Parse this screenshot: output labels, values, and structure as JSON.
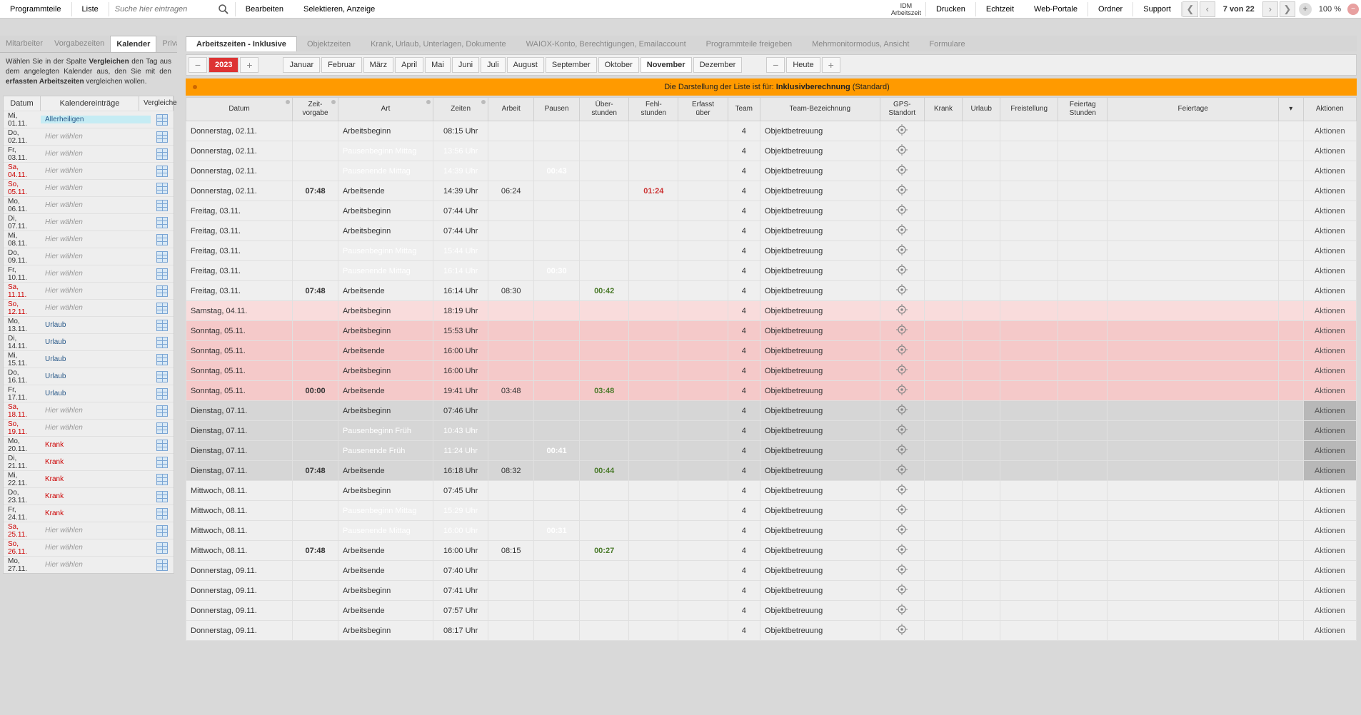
{
  "toolbar": {
    "programmteile": "Programmteile",
    "liste": "Liste",
    "search_placeholder": "Suche hier eintragen",
    "bearbeiten": "Bearbeiten",
    "selektieren": "Selektieren, Anzeige",
    "idm_line1": "IDM",
    "idm_line2": "Arbeitszeit",
    "drucken": "Drucken",
    "echtzeit": "Echtzeit",
    "webportale": "Web-Portale",
    "ordner": "Ordner",
    "support": "Support",
    "page_counter": "7 von 22",
    "zoom": "100 %"
  },
  "sidebar": {
    "tabs": [
      "Mitarbeiter",
      "Vorgabezeiten",
      "Kalender",
      "Privatdaten"
    ],
    "active_tab": 2,
    "info_parts": [
      "Wählen Sie in der Spalte ",
      "Vergleichen",
      " den Tag aus dem angelegten Kalender aus, den Sie mit den ",
      "erfassten Arbeitszeiten",
      " vergleichen wollen."
    ],
    "cal_head": {
      "date": "Datum",
      "entry": "Kalendereinträge",
      "cmp": "Vergleichen"
    },
    "cal_rows": [
      {
        "date": "Mi, 01.11.",
        "entry": "Allerheiligen",
        "cls": "holiday"
      },
      {
        "date": "Do, 02.11.",
        "entry": "Hier wählen",
        "cls": ""
      },
      {
        "date": "Fr, 03.11.",
        "entry": "Hier wählen",
        "cls": ""
      },
      {
        "date": "Sa, 04.11.",
        "entry": "Hier wählen",
        "cls": "",
        "dcls": "sat"
      },
      {
        "date": "So, 05.11.",
        "entry": "Hier wählen",
        "cls": "",
        "dcls": "sun"
      },
      {
        "date": "Mo, 06.11.",
        "entry": "Hier wählen",
        "cls": ""
      },
      {
        "date": "Di, 07.11.",
        "entry": "Hier wählen",
        "cls": ""
      },
      {
        "date": "Mi, 08.11.",
        "entry": "Hier wählen",
        "cls": ""
      },
      {
        "date": "Do, 09.11.",
        "entry": "Hier wählen",
        "cls": ""
      },
      {
        "date": "Fr, 10.11.",
        "entry": "Hier wählen",
        "cls": ""
      },
      {
        "date": "Sa, 11.11.",
        "entry": "Hier wählen",
        "cls": "",
        "dcls": "sat"
      },
      {
        "date": "So, 12.11.",
        "entry": "Hier wählen",
        "cls": "",
        "dcls": "sun"
      },
      {
        "date": "Mo, 13.11.",
        "entry": "Urlaub",
        "cls": "urlaub"
      },
      {
        "date": "Di, 14.11.",
        "entry": "Urlaub",
        "cls": "urlaub"
      },
      {
        "date": "Mi, 15.11.",
        "entry": "Urlaub",
        "cls": "urlaub"
      },
      {
        "date": "Do, 16.11.",
        "entry": "Urlaub",
        "cls": "urlaub"
      },
      {
        "date": "Fr, 17.11.",
        "entry": "Urlaub",
        "cls": "urlaub"
      },
      {
        "date": "Sa, 18.11.",
        "entry": "Hier wählen",
        "cls": "",
        "dcls": "sat"
      },
      {
        "date": "So, 19.11.",
        "entry": "Hier wählen",
        "cls": "",
        "dcls": "sun"
      },
      {
        "date": "Mo, 20.11.",
        "entry": "Krank",
        "cls": "krank"
      },
      {
        "date": "Di, 21.11.",
        "entry": "Krank",
        "cls": "krank"
      },
      {
        "date": "Mi, 22.11.",
        "entry": "Krank",
        "cls": "krank"
      },
      {
        "date": "Do, 23.11.",
        "entry": "Krank",
        "cls": "krank"
      },
      {
        "date": "Fr, 24.11.",
        "entry": "Krank",
        "cls": "krank"
      },
      {
        "date": "Sa, 25.11.",
        "entry": "Hier wählen",
        "cls": "",
        "dcls": "sat"
      },
      {
        "date": "So, 26.11.",
        "entry": "Hier wählen",
        "cls": "",
        "dcls": "sun"
      },
      {
        "date": "Mo, 27.11.",
        "entry": "Hier wählen",
        "cls": ""
      }
    ]
  },
  "main_tabs": [
    "Arbeitszeiten - Inklusive",
    "Objektzeiten",
    "Krank, Urlaub, Unterlagen, Dokumente",
    "WAIOX-Konto, Berechtigungen, Emailaccount",
    "Programmteile freigeben",
    "Mehrmonitormodus, Ansicht",
    "Formulare"
  ],
  "main_tab_active": 0,
  "ym": {
    "year": "2023",
    "months": [
      "Januar",
      "Februar",
      "März",
      "April",
      "Mai",
      "Juni",
      "Juli",
      "August",
      "September",
      "Oktober",
      "November",
      "Dezember"
    ],
    "current": "November",
    "heute": "Heute"
  },
  "notice": {
    "pre": "Die Darstellung der Liste ist für: ",
    "bold": "Inklusivberechnung",
    "post": " (Standard)"
  },
  "dt_head": {
    "date": "Datum",
    "vorg": "Zeit-\nvorgabe",
    "art": "Art",
    "zeit": "Zeiten",
    "arb": "Arbeit",
    "pau": "Pausen",
    "over": "Über-\nstunden",
    "fehl": "Fehl-\nstunden",
    "erf": "Erfasst\nüber",
    "team": "Team",
    "teamb": "Team-Bezeichnung",
    "gps": "GPS-\nStandort",
    "krank": "Krank",
    "urlaub": "Urlaub",
    "frei": "Freistellung",
    "fstd": "Feiertag\nStunden",
    "feier": "Feiertage",
    "act": "Aktionen"
  },
  "rows": [
    {
      "rcls": "r-std",
      "date": "Donnerstag, 02.11.",
      "vorg": "",
      "art": "Arbeitsbeginn",
      "artcls": "c-art",
      "zeit": "08:15 Uhr",
      "zcls": "c-time",
      "arb": "",
      "pau": "",
      "over": "",
      "fehl": "",
      "team": "4",
      "teamb": "Objektbetreuung"
    },
    {
      "rcls": "r-std",
      "date": "Donnerstag, 02.11.",
      "vorg": "",
      "art": "Pausenbeginn Mittag",
      "artcls": "c-art-blue",
      "zeit": "13:56 Uhr",
      "zcls": "c-time-blue",
      "arb": "",
      "pau": "",
      "over": "",
      "fehl": "",
      "team": "4",
      "teamb": "Objektbetreuung"
    },
    {
      "rcls": "r-std",
      "date": "Donnerstag, 02.11.",
      "vorg": "",
      "art": "Pausenende Mittag",
      "artcls": "c-art-blue",
      "zeit": "14:39 Uhr",
      "zcls": "c-time-blue",
      "arb": "",
      "pau": "00:43",
      "paucls": "c-pause-blue",
      "over": "",
      "fehl": "",
      "team": "4",
      "teamb": "Objektbetreuung"
    },
    {
      "rcls": "r-std",
      "date": "Donnerstag, 02.11.",
      "vorg": "07:48",
      "art": "Arbeitsende",
      "artcls": "c-art",
      "zeit": "14:39 Uhr",
      "zcls": "c-time",
      "arb": "06:24",
      "over": "",
      "fehl": "01:24",
      "fehlcls": "red",
      "team": "4",
      "teamb": "Objektbetreuung",
      "efrei": true
    },
    {
      "rcls": "r-std",
      "date": "Freitag, 03.11.",
      "vorg": "",
      "art": "Arbeitsbeginn",
      "artcls": "c-art",
      "zeit": "07:44 Uhr",
      "zcls": "c-time",
      "team": "4",
      "teamb": "Objektbetreuung"
    },
    {
      "rcls": "r-std",
      "date": "Freitag, 03.11.",
      "vorg": "",
      "art": "Arbeitsbeginn",
      "artcls": "c-art",
      "zeit": "07:44 Uhr",
      "zcls": "c-time",
      "team": "4",
      "teamb": "Objektbetreuung"
    },
    {
      "rcls": "r-std",
      "date": "Freitag, 03.11.",
      "vorg": "",
      "art": "Pausenbeginn Mittag",
      "artcls": "c-art-blue",
      "zeit": "15:44 Uhr",
      "zcls": "c-time-blue",
      "team": "4",
      "teamb": "Objektbetreuung"
    },
    {
      "rcls": "r-std",
      "date": "Freitag, 03.11.",
      "vorg": "",
      "art": "Pausenende Mittag",
      "artcls": "c-art-blue",
      "zeit": "16:14 Uhr",
      "zcls": "c-time-blue",
      "pau": "00:30",
      "paucls": "c-pause-blue",
      "team": "4",
      "teamb": "Objektbetreuung"
    },
    {
      "rcls": "r-std",
      "date": "Freitag, 03.11.",
      "vorg": "07:48",
      "art": "Arbeitsende",
      "artcls": "c-art",
      "zeit": "16:14 Uhr",
      "zcls": "c-time",
      "arb": "08:30",
      "over": "00:42",
      "team": "4",
      "teamb": "Objektbetreuung",
      "efrei": true
    },
    {
      "rcls": "r-pinklight",
      "date": "Samstag, 04.11.",
      "vorg": "",
      "art": "Arbeitsbeginn",
      "artcls": "c-art",
      "zeit": "18:19 Uhr",
      "zcls": "c-time",
      "team": "4",
      "teamb": "Objektbetreuung"
    },
    {
      "rcls": "r-pink",
      "date": "Sonntag, 05.11.",
      "vorg": "",
      "art": "Arbeitsbeginn",
      "artcls": "c-art",
      "zeit": "15:53 Uhr",
      "zcls": "c-time",
      "team": "4",
      "teamb": "Objektbetreuung"
    },
    {
      "rcls": "r-pink",
      "date": "Sonntag, 05.11.",
      "vorg": "",
      "art": "Arbeitsende",
      "artcls": "c-art",
      "zeit": "16:00 Uhr",
      "zcls": "c-time",
      "team": "4",
      "teamb": "Objektbetreuung"
    },
    {
      "rcls": "r-pink",
      "date": "Sonntag, 05.11.",
      "vorg": "",
      "art": "Arbeitsbeginn",
      "artcls": "c-art",
      "zeit": "16:00 Uhr",
      "zcls": "c-time",
      "team": "4",
      "teamb": "Objektbetreuung"
    },
    {
      "rcls": "r-pink",
      "date": "Sonntag, 05.11.",
      "vorg": "00:00",
      "art": "Arbeitsende",
      "artcls": "c-art",
      "zeit": "19:41 Uhr",
      "zcls": "c-time",
      "arb": "03:48",
      "over": "03:48",
      "team": "4",
      "teamb": "Objektbetreuung",
      "efrei": true
    },
    {
      "rcls": "r-grey",
      "date": "Dienstag, 07.11.",
      "vorg": "",
      "art": "Arbeitsbeginn",
      "artcls": "c-art",
      "zeit": "07:46 Uhr",
      "zcls": "c-time",
      "team": "4",
      "teamb": "Objektbetreuung"
    },
    {
      "rcls": "r-grey",
      "date": "Dienstag, 07.11.",
      "vorg": "",
      "art": "Pausenbeginn Früh",
      "artcls": "c-art-blue2",
      "zeit": "10:43 Uhr",
      "zcls": "c-time-blue2",
      "team": "4",
      "teamb": "Objektbetreuung"
    },
    {
      "rcls": "r-grey",
      "date": "Dienstag, 07.11.",
      "vorg": "",
      "art": "Pausenende Früh",
      "artcls": "c-art-blue2",
      "zeit": "11:24 Uhr",
      "zcls": "c-time-blue2",
      "pau": "00:41",
      "paucls": "c-pause-blue",
      "team": "4",
      "teamb": "Objektbetreuung"
    },
    {
      "rcls": "r-grey",
      "date": "Dienstag, 07.11.",
      "vorg": "07:48",
      "art": "Arbeitsende",
      "artcls": "c-art",
      "zeit": "16:18 Uhr",
      "zcls": "c-time",
      "arb": "08:32",
      "over": "00:44",
      "team": "4",
      "teamb": "Objektbetreuung",
      "efrei": true
    },
    {
      "rcls": "r-std",
      "date": "Mittwoch, 08.11.",
      "vorg": "",
      "art": "Arbeitsbeginn",
      "artcls": "c-art",
      "zeit": "07:45 Uhr",
      "zcls": "c-time",
      "team": "4",
      "teamb": "Objektbetreuung"
    },
    {
      "rcls": "r-std",
      "date": "Mittwoch, 08.11.",
      "vorg": "",
      "art": "Pausenbeginn Mittag",
      "artcls": "c-art-blue",
      "zeit": "15:29 Uhr",
      "zcls": "c-time-blue",
      "team": "4",
      "teamb": "Objektbetreuung"
    },
    {
      "rcls": "r-std",
      "date": "Mittwoch, 08.11.",
      "vorg": "",
      "art": "Pausenende Mittag",
      "artcls": "c-art-blue",
      "zeit": "16:00 Uhr",
      "zcls": "c-time-blue",
      "pau": "00:31",
      "paucls": "c-pause-blue",
      "team": "4",
      "teamb": "Objektbetreuung"
    },
    {
      "rcls": "r-std",
      "date": "Mittwoch, 08.11.",
      "vorg": "07:48",
      "art": "Arbeitsende",
      "artcls": "c-art",
      "zeit": "16:00 Uhr",
      "zcls": "c-time",
      "arb": "08:15",
      "over": "00:27",
      "team": "4",
      "teamb": "Objektbetreuung",
      "efrei": true
    },
    {
      "rcls": "r-std",
      "date": "Donnerstag, 09.11.",
      "vorg": "",
      "art": "Arbeitsende",
      "artcls": "c-art",
      "zeit": "07:40 Uhr",
      "zcls": "c-time",
      "team": "4",
      "teamb": "Objektbetreuung"
    },
    {
      "rcls": "r-std",
      "date": "Donnerstag, 09.11.",
      "vorg": "",
      "art": "Arbeitsbeginn",
      "artcls": "c-art",
      "zeit": "07:41 Uhr",
      "zcls": "c-time",
      "team": "4",
      "teamb": "Objektbetreuung"
    },
    {
      "rcls": "r-std",
      "date": "Donnerstag, 09.11.",
      "vorg": "",
      "art": "Arbeitsende",
      "artcls": "c-art",
      "zeit": "07:57 Uhr",
      "zcls": "c-time",
      "team": "4",
      "teamb": "Objektbetreuung"
    },
    {
      "rcls": "r-std",
      "date": "Donnerstag, 09.11.",
      "vorg": "",
      "art": "Arbeitsbeginn",
      "artcls": "c-art",
      "zeit": "08:17 Uhr",
      "zcls": "c-time",
      "team": "4",
      "teamb": "Objektbetreuung"
    }
  ],
  "act_label": "Aktionen"
}
